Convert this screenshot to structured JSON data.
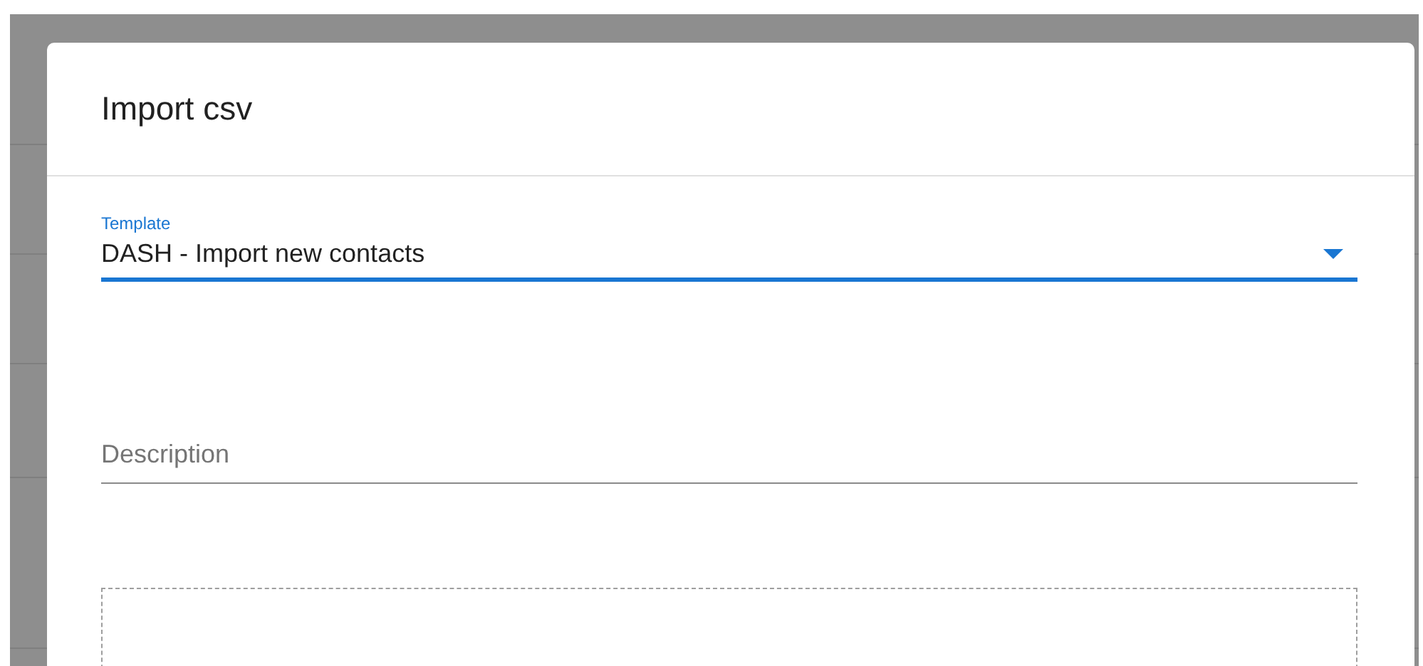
{
  "dialog": {
    "title": "Import csv",
    "template_field": {
      "label": "Template",
      "value": "DASH - Import new contacts",
      "focused": true
    },
    "description_field": {
      "placeholder": "Description"
    },
    "drop_zone": {
      "kind": "dashed"
    }
  }
}
